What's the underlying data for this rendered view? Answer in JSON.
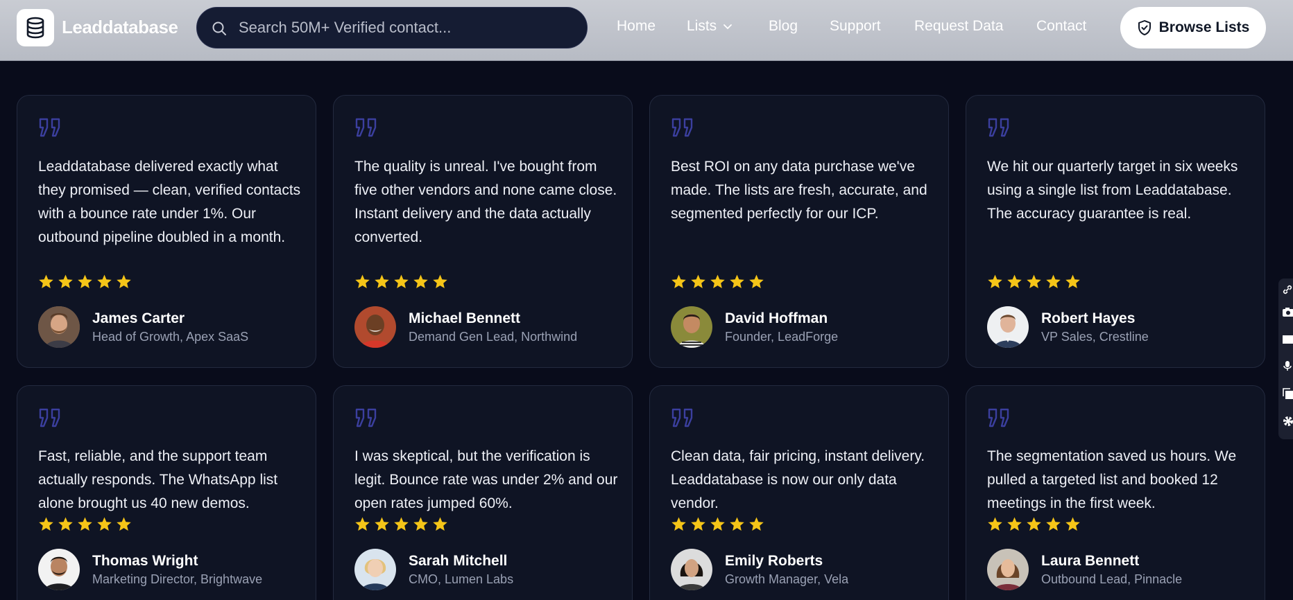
{
  "header": {
    "logo_text": "Leaddatabase",
    "search_placeholder": "Search 50M+ Verified contact...",
    "nav": [
      "Home",
      "Lists",
      "Blog",
      "Support",
      "Request Data",
      "Contact"
    ],
    "browse_label": "Browse Lists"
  },
  "colors": {
    "background": "#090c1b",
    "card": "#0f1424",
    "star": "#f5c518",
    "quote_icon": "#3b3f9e"
  },
  "testimonials": [
    {
      "text": "Leaddatabase delivered exactly what they promised — clean, verified contacts with a bounce rate under 1%. Our outbound pipeline doubled in a month.",
      "rating": 5,
      "name": "James Carter",
      "role": "Head of Growth, Apex SaaS"
    },
    {
      "text": "The quality is unreal. I've bought from five other vendors and none came close. Instant delivery and the data actually converted.",
      "rating": 5,
      "name": "Michael Bennett",
      "role": "Demand Gen Lead, Northwind"
    },
    {
      "text": "Best ROI on any data purchase we've made. The lists are fresh, accurate, and segmented perfectly for our ICP.",
      "rating": 5,
      "name": "David Hoffman",
      "role": "Founder, LeadForge"
    },
    {
      "text": "We hit our quarterly target in six weeks using a single list from Leaddatabase. The accuracy guarantee is real.",
      "rating": 5,
      "name": "Robert Hayes",
      "role": "VP Sales, Crestline"
    },
    {
      "text": "Fast, reliable, and the support team actually responds. The WhatsApp list alone brought us 40 new demos.",
      "rating": 5,
      "name": "Thomas Wright",
      "role": "Marketing Director, Brightwave"
    },
    {
      "text": "I was skeptical, but the verification is legit. Bounce rate was under 2% and our open rates jumped 60%.",
      "rating": 5,
      "name": "Sarah Mitchell",
      "role": "CMO, Lumen Labs"
    },
    {
      "text": "Clean data, fair pricing, instant delivery. Leaddatabase is now our only data vendor.",
      "rating": 5,
      "name": "Emily Roberts",
      "role": "Growth Manager, Vela"
    },
    {
      "text": "The segmentation saved us hours. We pulled a targeted list and booked 12 meetings in the first week.",
      "rating": 5,
      "name": "Laura Bennett",
      "role": "Outbound Lead, Pinnacle"
    }
  ]
}
